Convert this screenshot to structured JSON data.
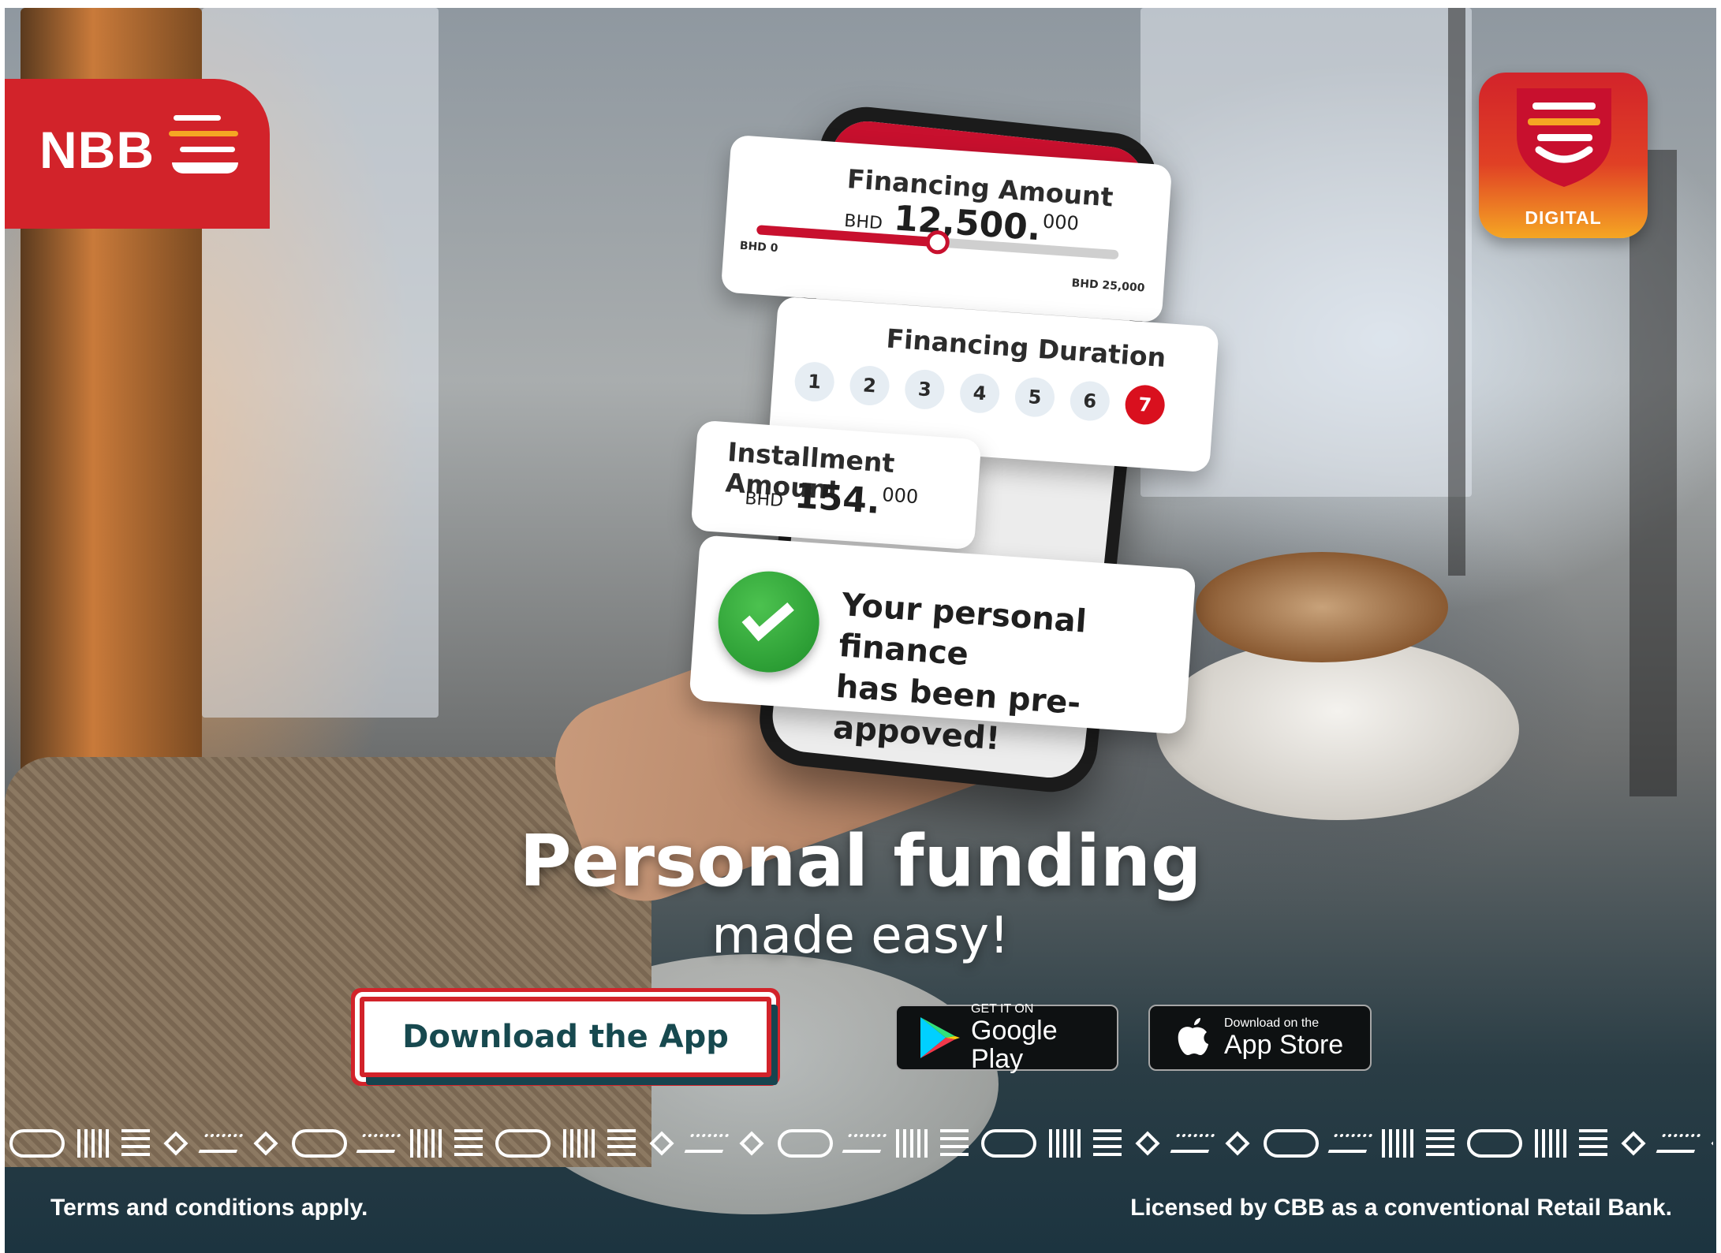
{
  "brand": {
    "logo_text": "NBB",
    "digital_label": "DIGITAL",
    "red": "#d2232a",
    "teal": "#17494f",
    "gold": "#f5a623"
  },
  "phone_ui": {
    "financing": {
      "title": "Financing Amount",
      "currency": "BHD",
      "amount_main": "12,500.",
      "amount_decimal": "000",
      "min_label": "BHD 0",
      "max_label": "BHD 25,000",
      "slider_fraction": 0.5
    },
    "duration": {
      "title": "Financing Duration",
      "options": [
        "1",
        "2",
        "3",
        "4",
        "5",
        "6",
        "7"
      ],
      "selected": "7"
    },
    "installment": {
      "title": "Installment Amount",
      "currency": "BHD",
      "amount_main": "154.",
      "amount_decimal": "000"
    },
    "approval": {
      "line1": "Your personal finance",
      "line2": "has been pre-appoved!",
      "icon": "check-circle-icon"
    }
  },
  "headline": {
    "line1": "Personal funding",
    "line2": "made easy!"
  },
  "cta": {
    "download_label": "Download the App"
  },
  "stores": {
    "google": {
      "small": "GET IT ON",
      "big": "Google Play",
      "icon": "google-play-icon"
    },
    "apple": {
      "small": "Download on the",
      "big": "App Store",
      "icon": "apple-icon"
    }
  },
  "footer": {
    "left": "Terms and conditions apply.",
    "right": "Licensed by CBB as a conventional Retail Bank."
  }
}
